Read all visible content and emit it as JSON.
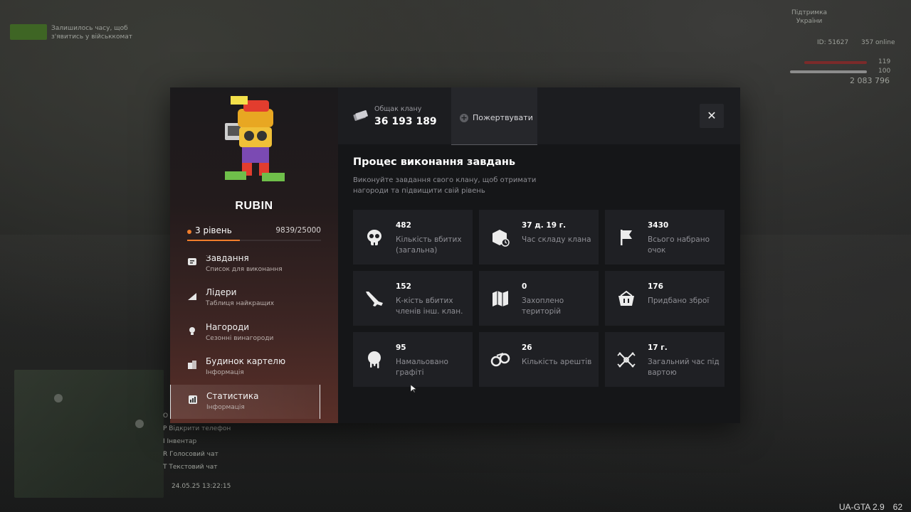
{
  "hud": {
    "notice": "Залишилось часу, щоб\nз'явитись у військкомат",
    "sponsor": "Підтримка\nУкраїни",
    "id": "ID: 51627",
    "online": "357 online",
    "health": "119",
    "armor": "100",
    "money": "2 083 796",
    "controls": [
      "O",
      "P  Відкрити телефон",
      "I  Інвентар",
      "R  Голосовий чат",
      "T  Текстовий чат"
    ],
    "datetime": "24.05.25 13:22:15",
    "version": "UA-GTA 2.9",
    "fps": "62"
  },
  "clan": {
    "name": "RUBIN",
    "level_label": "3 рівень",
    "xp": "9839/25000",
    "xp_progress": 0.3936
  },
  "menu": [
    {
      "title": "Завдання",
      "subtitle": "Список для виконання",
      "icon": "chat-icon"
    },
    {
      "title": "Лідери",
      "subtitle": "Таблиця найкращих",
      "icon": "chart-icon"
    },
    {
      "title": "Нагороди",
      "subtitle": "Сезонні винагороди",
      "icon": "medal-icon"
    },
    {
      "title": "Будинок картелю",
      "subtitle": "Інформація",
      "icon": "building-icon"
    },
    {
      "title": "Статистика",
      "subtitle": "Інформація",
      "icon": "stats-icon",
      "active": true
    }
  ],
  "treasury": {
    "label": "Общак клану",
    "value": "36 193 189",
    "icon": "money-icon"
  },
  "donate_label": "Пожертвувати",
  "close_icon": "close-icon",
  "section": {
    "title": "Процес виконання завдань",
    "description": "Виконуйте завдання свого клану, щоб отримати нагороди та підвищити свій рівень"
  },
  "stats": [
    {
      "value": "482",
      "label": "Кількість вбитих (загальна)",
      "icon": "skull-icon"
    },
    {
      "value": "37 д. 19 г.",
      "label": "Час складу клана",
      "icon": "box-clock-icon"
    },
    {
      "value": "3430",
      "label": "Всього набрано очок",
      "icon": "flag-icon"
    },
    {
      "value": "152",
      "label": "К-кість вбитих членів інш. клан.",
      "icon": "rifle-icon"
    },
    {
      "value": "0",
      "label": "Захоплено територій",
      "icon": "map-icon"
    },
    {
      "value": "176",
      "label": "Придбано зброї",
      "icon": "basket-icon"
    },
    {
      "value": "95",
      "label": "Намальовано графіті",
      "icon": "spray-icon"
    },
    {
      "value": "26",
      "label": "Кількість арештів",
      "icon": "handcuffs-icon"
    },
    {
      "value": "17 г.",
      "label": "Загальний час під вартою",
      "icon": "barbed-wire-icon"
    }
  ],
  "colors": {
    "accent": "#f07d2b",
    "card": "#1f2024",
    "panel": "#151618"
  }
}
